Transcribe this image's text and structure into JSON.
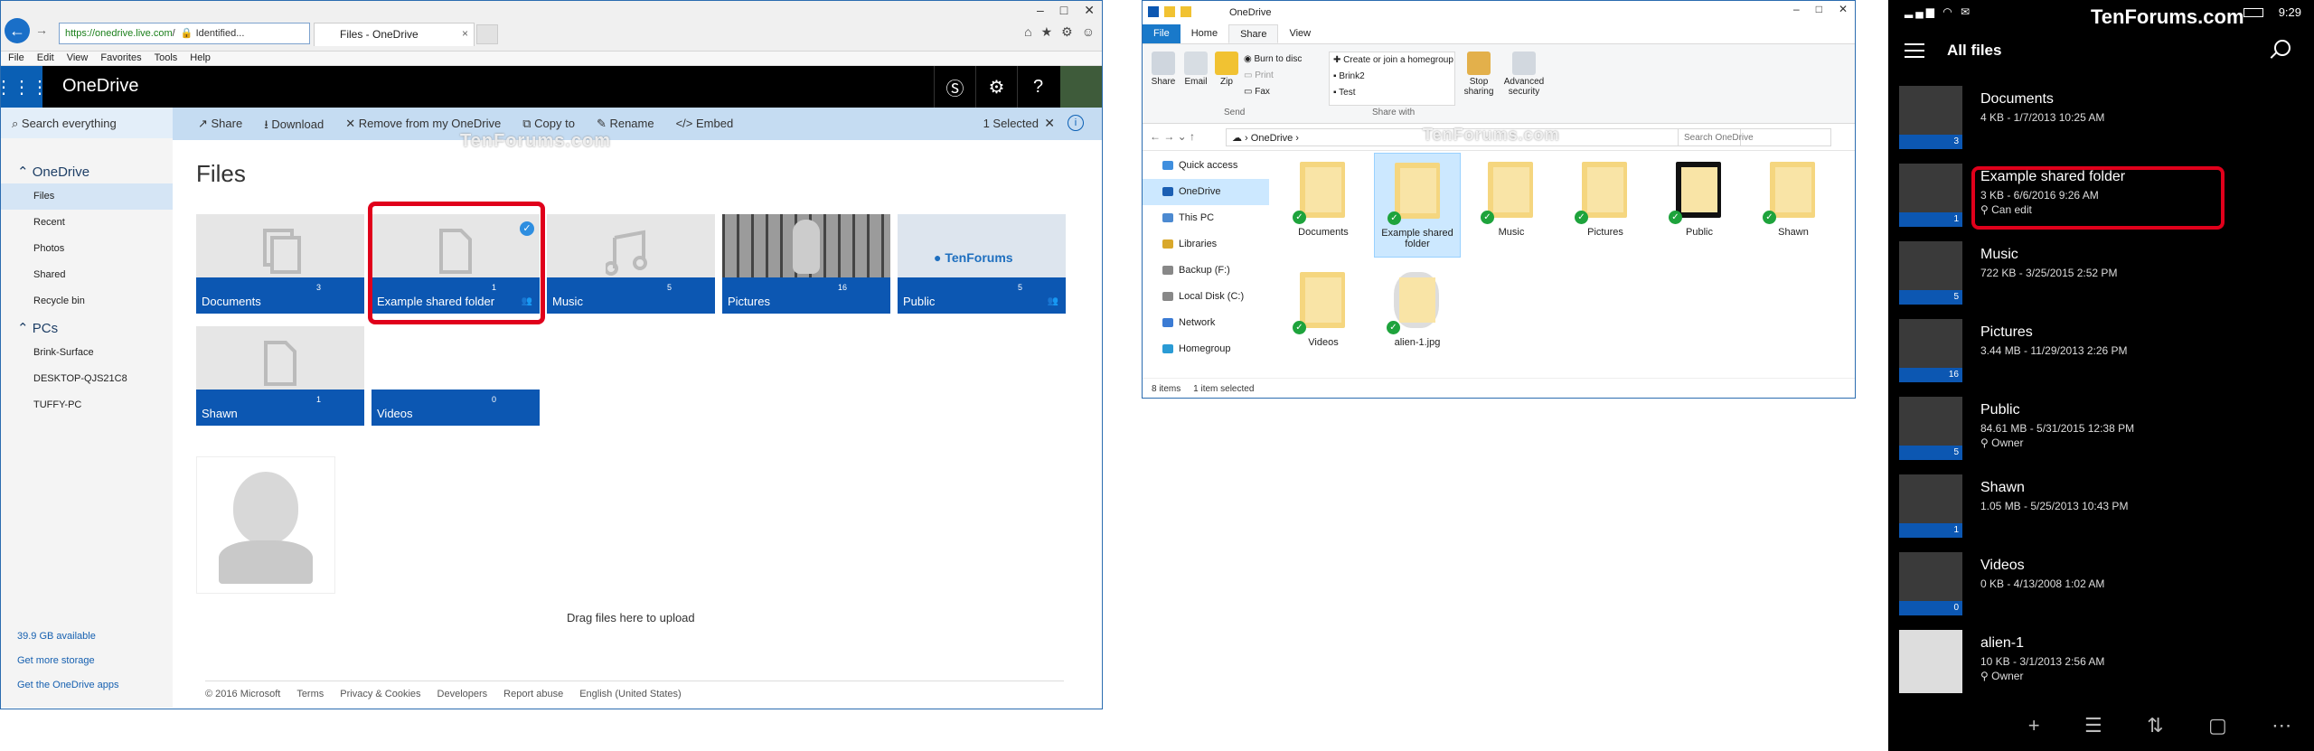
{
  "ie": {
    "address": "https://onedrive.live.com",
    "address_rest": "/",
    "identified": "Identified...",
    "tab_title": "Files - OneDrive",
    "menu": [
      "File",
      "Edit",
      "View",
      "Favorites",
      "Tools",
      "Help"
    ],
    "brand": "OneDrive",
    "search_placeholder": "Search everything",
    "commands": [
      "Share",
      "Download",
      "Remove from my OneDrive",
      "Copy to",
      "Rename",
      "Embed"
    ],
    "selected_text": "1 Selected",
    "sidebar": {
      "onedrive_header": "OneDrive",
      "items": [
        "Files",
        "Recent",
        "Photos",
        "Shared",
        "Recycle bin"
      ],
      "pcs_header": "PCs",
      "pcs": [
        "Brink-Surface",
        "DESKTOP-QJS21C8",
        "TUFFY-PC"
      ],
      "storage": "39.9 GB available",
      "get_more": "Get more storage",
      "get_apps": "Get the OneDrive apps"
    },
    "page_title": "Files",
    "tiles": [
      {
        "name": "Documents",
        "count": "3"
      },
      {
        "name": "Example shared folder",
        "count": "1"
      },
      {
        "name": "Music",
        "count": "5"
      },
      {
        "name": "Pictures",
        "count": "16"
      },
      {
        "name": "Public",
        "count": "5"
      },
      {
        "name": "Shawn",
        "count": "1"
      },
      {
        "name": "Videos",
        "count": "0"
      }
    ],
    "public_logo": "TenForums",
    "drag_text": "Drag files here to upload",
    "footer": [
      "© 2016 Microsoft",
      "Terms",
      "Privacy & Cookies",
      "Developers",
      "Report abuse",
      "English (United States)"
    ]
  },
  "watermark": "TenForums.com",
  "explorer": {
    "title": "OneDrive",
    "tabs": [
      "File",
      "Home",
      "Share",
      "View"
    ],
    "ribbon": {
      "share": "Share",
      "email": "Email",
      "zip": "Zip",
      "burn": "Burn to disc",
      "print": "Print",
      "fax": "Fax",
      "send_group": "Send",
      "homegroup": "Create or join a homegroup",
      "user1": "Brink2",
      "user2": "Test",
      "share_with_group": "Share with",
      "stop_sharing": "Stop sharing",
      "advanced_security": "Advanced security"
    },
    "path": "OneDrive",
    "search_placeholder": "Search OneDrive",
    "tree": [
      "Quick access",
      "OneDrive",
      "This PC",
      "Libraries",
      "Backup (F:)",
      "Local Disk (C:)",
      "Network",
      "Homegroup"
    ],
    "files": [
      "Documents",
      "Example shared folder",
      "Music",
      "Pictures",
      "Public",
      "Shawn",
      "Videos",
      "alien-1.jpg"
    ],
    "status_items": "8 items",
    "status_selected": "1 item selected"
  },
  "phone": {
    "time": "9:29",
    "title": "All files",
    "rows": [
      {
        "name": "Documents",
        "meta": "4 KB - 1/7/2013 10:25 AM",
        "sub": "",
        "count": "3"
      },
      {
        "name": "Example shared folder",
        "meta": "3 KB - 6/6/2016 9:26 AM",
        "sub": "Can edit",
        "count": "1"
      },
      {
        "name": "Music",
        "meta": "722 KB - 3/25/2015 2:52 PM",
        "sub": "",
        "count": "5"
      },
      {
        "name": "Pictures",
        "meta": "3.44 MB - 11/29/2013 2:26 PM",
        "sub": "",
        "count": "16"
      },
      {
        "name": "Public",
        "meta": "84.61 MB - 5/31/2015 12:38 PM",
        "sub": "Owner",
        "count": "5"
      },
      {
        "name": "Shawn",
        "meta": "1.05 MB - 5/25/2013 10:43 PM",
        "sub": "",
        "count": "1"
      },
      {
        "name": "Videos",
        "meta": "0 KB - 4/13/2008 1:02 AM",
        "sub": "",
        "count": "0"
      },
      {
        "name": "alien-1",
        "meta": "10 KB - 3/1/2013 2:56 AM",
        "sub": "Owner",
        "count": ""
      }
    ],
    "bottom": [
      "+",
      "☰",
      "⇅",
      "▢",
      "⋯"
    ]
  },
  "colors": {
    "accent": "#0c57b2",
    "highlight": "#e0001b",
    "sidebar_active": "#d5e5f5"
  }
}
